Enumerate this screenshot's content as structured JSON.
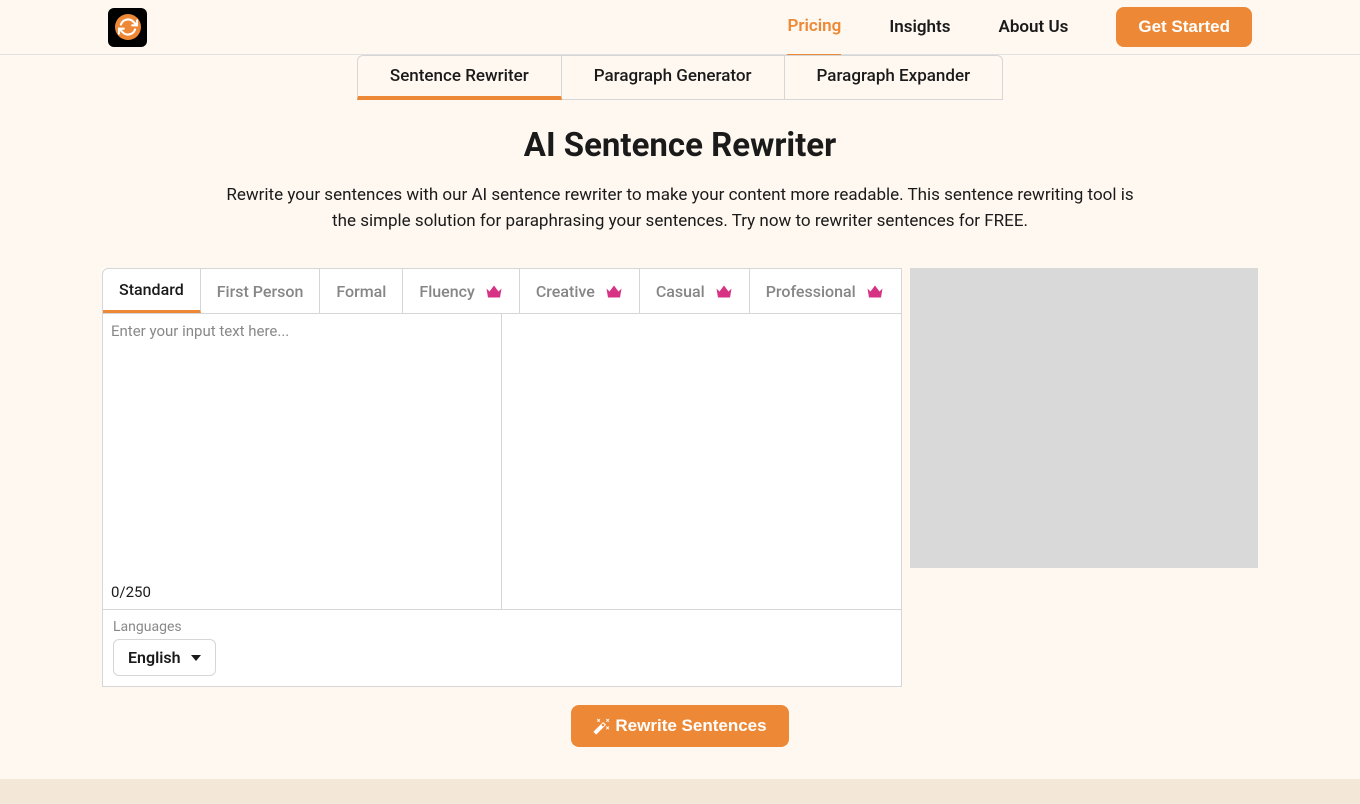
{
  "header": {
    "nav": {
      "pricing": "Pricing",
      "insights": "Insights",
      "about": "About Us"
    },
    "cta": "Get Started"
  },
  "tool_tabs": {
    "sentence_rewriter": "Sentence Rewriter",
    "paragraph_generator": "Paragraph Generator",
    "paragraph_expander": "Paragraph Expander"
  },
  "page": {
    "title": "AI Sentence Rewriter",
    "description": "Rewrite your sentences with our AI sentence rewriter to make your content more readable. This sentence rewriting tool is the simple solution for paraphrasing your sentences. Try now to rewriter sentences for FREE."
  },
  "style_tabs": {
    "standard": "Standard",
    "first_person": "First Person",
    "formal": "Formal",
    "fluency": "Fluency",
    "creative": "Creative",
    "casual": "Casual",
    "professional": "Professional"
  },
  "editor": {
    "input_placeholder": "Enter your input text here...",
    "char_count": "0/250"
  },
  "language": {
    "label": "Languages",
    "selected": "English"
  },
  "action": {
    "rewrite": "Rewrite Sentences"
  },
  "colors": {
    "accent": "#ed8936",
    "crown": "#d63384"
  }
}
